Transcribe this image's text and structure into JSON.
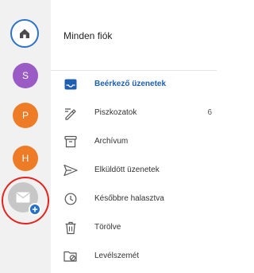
{
  "accounts": [
    {
      "letter": "S",
      "color": "#9a5bc4"
    },
    {
      "letter": "P",
      "color": "#ee7b26"
    },
    {
      "letter": "H",
      "color": "#ee7b26"
    }
  ],
  "header": {
    "title": "Minden fiók"
  },
  "folders": [
    {
      "label": "Beérkező üzenetek",
      "icon": "inbox-icon",
      "active": true
    },
    {
      "label": "Piszkozatok",
      "icon": "draft-icon",
      "count": "6"
    },
    {
      "label": "Archívum",
      "icon": "archive-icon"
    },
    {
      "label": "Elküldött üzenetek",
      "icon": "send-icon"
    },
    {
      "label": "Későbbre halasztva",
      "icon": "clock-icon"
    },
    {
      "label": "Törölve",
      "icon": "trash-icon"
    },
    {
      "label": "Levélszemét",
      "icon": "junk-folder-icon"
    }
  ],
  "colors": {
    "accent": "#2370c8",
    "annotation": "#e3251f"
  }
}
